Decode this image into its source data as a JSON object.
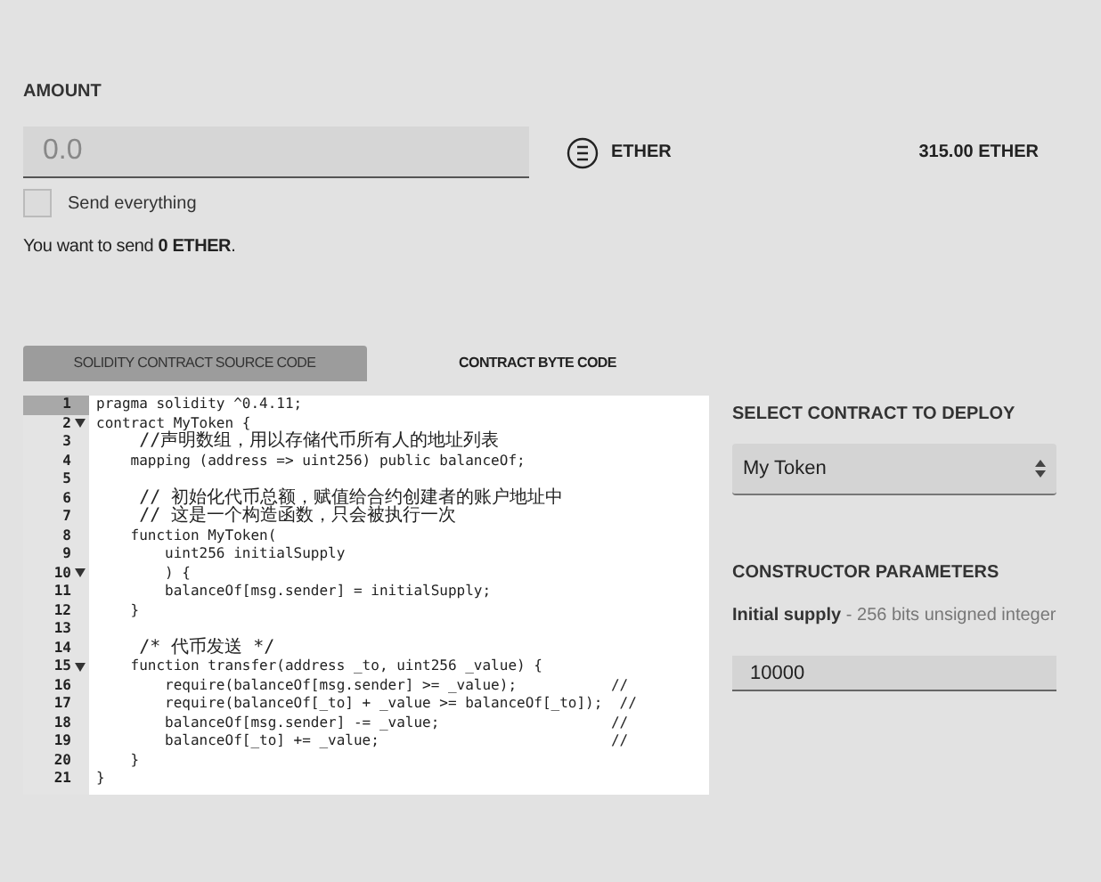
{
  "amount": {
    "label": "AMOUNT",
    "placeholder": "0.0",
    "unit": "ETHER",
    "balance": "315.00 ETHER"
  },
  "send_everything": {
    "label": "Send everything",
    "checked": false
  },
  "summary": "You want to send **0 ETHER**.",
  "tabs": [
    {
      "label": "SOLIDITY CONTRACT SOURCE CODE",
      "selected": true
    },
    {
      "label": "CONTRACT BYTE CODE",
      "selected": false
    }
  ],
  "code": [
    {
      "number": "1",
      "text": "pragma solidity ^0.4.11;",
      "foldable": false,
      "active": true
    },
    {
      "number": "2",
      "text": "contract MyToken {",
      "foldable": true,
      "active": false
    },
    {
      "number": "3",
      "text": "    //声明数组，用以存储代币所有人的地址列表",
      "foldable": false,
      "active": false
    },
    {
      "number": "4",
      "text": "    mapping (address => uint256) public balanceOf;",
      "foldable": false,
      "active": false
    },
    {
      "number": "5",
      "foldable": false,
      "active": false
    },
    {
      "number": "6",
      "text": "    // 初始化代币总额，赋值给合约创建者的账户地址中",
      "foldable": false,
      "active": false
    },
    {
      "number": "7",
      "text": "    // 这是一个构造函数，只会被执行一次",
      "foldable": false,
      "active": false
    },
    {
      "number": "8",
      "text": "    function MyToken(",
      "foldable": false,
      "active": false
    },
    {
      "number": "9",
      "text": "        uint256 initialSupply",
      "foldable": false,
      "active": false
    },
    {
      "number": "10",
      "text": "        ) {",
      "foldable": true,
      "active": false
    },
    {
      "number": "11",
      "text": "        balanceOf[msg.sender] = initialSupply;",
      "foldable": false,
      "active": false
    },
    {
      "number": "12",
      "text": "    }",
      "foldable": false,
      "active": false
    },
    {
      "number": "13",
      "foldable": false,
      "active": false
    },
    {
      "number": "14",
      "text": "    /* 代币发送 */",
      "foldable": false,
      "active": false
    },
    {
      "number": "15",
      "text": "    function transfer(address _to, uint256 _value) {",
      "foldable": true,
      "active": false
    },
    {
      "number": "16",
      "text": "        require(balanceOf[msg.sender] >= _value);           //",
      "foldable": false,
      "active": false
    },
    {
      "number": "17",
      "text": "        require(balanceOf[_to] + _value >= balanceOf[_to]);  //",
      "foldable": false,
      "active": false
    },
    {
      "number": "18",
      "text": "        balanceOf[msg.sender] -= _value;                    //",
      "foldable": false,
      "active": false
    },
    {
      "number": "19",
      "text": "        balanceOf[_to] += _value;                           //",
      "foldable": false,
      "active": false
    },
    {
      "number": "20",
      "text": "    }",
      "foldable": false,
      "active": false
    },
    {
      "number": "21",
      "text": "}",
      "foldable": false,
      "active": false
    }
  ],
  "deploy": {
    "label": "SELECT CONTRACT TO DEPLOY",
    "value": "My Token"
  },
  "constructor": {
    "label": "CONSTRUCTOR PARAMETERS",
    "parameter": "**Initial supply** - 256 bits unsigned integer",
    "value": "10000"
  }
}
